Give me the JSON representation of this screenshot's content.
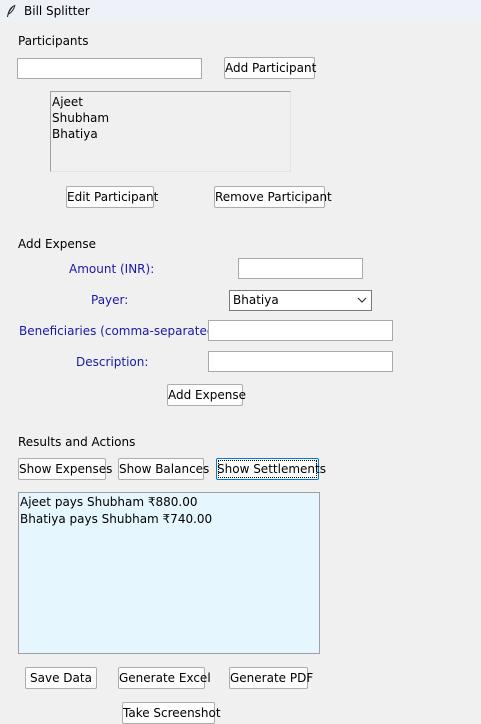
{
  "window": {
    "title": "Bill Splitter"
  },
  "participants": {
    "section_label": "Participants",
    "name_input_value": "",
    "add_button": "Add Participant",
    "list": [
      "Ajeet",
      "Shubham",
      "Bhatiya"
    ],
    "edit_button": "Edit Participant",
    "remove_button": "Remove Participant"
  },
  "expense": {
    "section_label": "Add Expense",
    "amount_label": "Amount (INR):",
    "amount_value": "",
    "payer_label": "Payer:",
    "payer_selected": "Bhatiya",
    "beneficiaries_label": "Beneficiaries (comma-separated):",
    "beneficiaries_value": "",
    "description_label": "Description:",
    "description_value": "",
    "add_button": "Add Expense"
  },
  "results": {
    "section_label": "Results and Actions",
    "show_expenses_button": "Show Expenses",
    "show_balances_button": "Show Balances",
    "show_settlements_button": "Show Settlements",
    "lines": [
      "Ajeet pays Shubham ₹880.00",
      "Bhatiya pays Shubham ₹740.00"
    ],
    "background_color": "#e6f6ff"
  },
  "actions": {
    "save_button": "Save Data",
    "excel_button": "Generate Excel",
    "pdf_button": "Generate PDF",
    "screenshot_button": "Take Screenshot"
  },
  "colors": {
    "label_blue": "#1a1aa8",
    "focus_border": "#0078d7"
  }
}
